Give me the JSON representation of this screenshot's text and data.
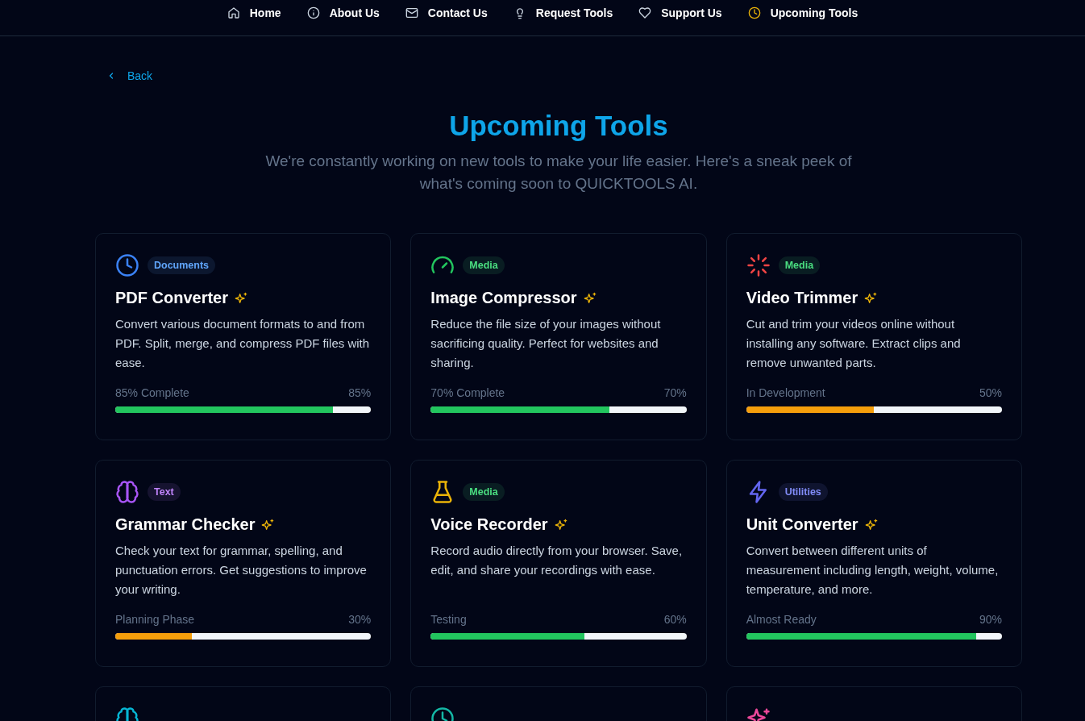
{
  "nav": [
    {
      "kind": "house",
      "label": "Home",
      "selected": false
    },
    {
      "kind": "info",
      "label": "About Us",
      "selected": false
    },
    {
      "kind": "mail",
      "label": "Contact Us",
      "selected": false
    },
    {
      "kind": "bulb",
      "label": "Request Tools",
      "selected": false
    },
    {
      "kind": "heart",
      "label": "Support Us",
      "selected": false
    },
    {
      "kind": "clock",
      "label": "Upcoming Tools",
      "selected": true
    }
  ],
  "back": {
    "label": "Back"
  },
  "title": "Upcoming Tools",
  "subtitle": "We're constantly working on new tools to make your life easier. Here's a sneak peek of what's coming soon to QUICKTOOLS AI.",
  "tools": [
    {
      "icon": {
        "kind": "clock",
        "color": "#3b82f6"
      },
      "tag": {
        "label": "Documents",
        "color": "#60a5fa"
      },
      "name": "PDF Converter",
      "description": "Convert various document formats to and from PDF. Split, merge, and compress PDF files with ease.",
      "progress": {
        "status": "85% Complete",
        "percent": "85%",
        "level": 0.85,
        "color": "#22c55e"
      }
    },
    {
      "icon": {
        "kind": "gauge",
        "color": "#22c55e"
      },
      "tag": {
        "label": "Media",
        "color": "#4ade80"
      },
      "name": "Image Compressor",
      "description": "Reduce the file size of your images without sacrificing quality. Perfect for websites and sharing.",
      "progress": {
        "status": "70% Complete",
        "percent": "70%",
        "level": 0.7,
        "color": "#22c55e"
      }
    },
    {
      "icon": {
        "kind": "loader",
        "color": "#ef4444"
      },
      "tag": {
        "label": "Media",
        "color": "#4ade80"
      },
      "name": "Video Trimmer",
      "description": "Cut and trim your videos online without installing any software. Extract clips and remove unwanted parts.",
      "progress": {
        "status": "In Development",
        "percent": "50%",
        "level": 0.5,
        "color": "#f59e0b"
      }
    },
    {
      "icon": {
        "kind": "brain",
        "color": "#a855f7"
      },
      "tag": {
        "label": "Text",
        "color": "#c084fc"
      },
      "name": "Grammar Checker",
      "description": "Check your text for grammar, spelling, and punctuation errors. Get suggestions to improve your writing.",
      "progress": {
        "status": "Planning Phase",
        "percent": "30%",
        "level": 0.3,
        "color": "#f59e0b"
      }
    },
    {
      "icon": {
        "kind": "flask",
        "color": "#eab308"
      },
      "tag": {
        "label": "Media",
        "color": "#4ade80"
      },
      "name": "Voice Recorder",
      "description": "Record audio directly from your browser. Save, edit, and share your recordings with ease.",
      "progress": {
        "status": "Testing",
        "percent": "60%",
        "level": 0.6,
        "color": "#22c55e"
      }
    },
    {
      "icon": {
        "kind": "zap",
        "color": "#6366f1"
      },
      "tag": {
        "label": "Utilities",
        "color": "#818cf8"
      },
      "name": "Unit Converter",
      "description": "Convert between different units of measurement including length, weight, volume, temperature, and more.",
      "progress": {
        "status": "Almost Ready",
        "percent": "90%",
        "level": 0.9,
        "color": "#22c55e"
      }
    },
    {
      "icon": {
        "kind": "brain",
        "color": "#06b6d4"
      }
    },
    {
      "icon": {
        "kind": "clock",
        "color": "#14b8a6"
      }
    },
    {
      "icon": {
        "kind": "sparkles",
        "color": "#ec4899"
      }
    }
  ]
}
